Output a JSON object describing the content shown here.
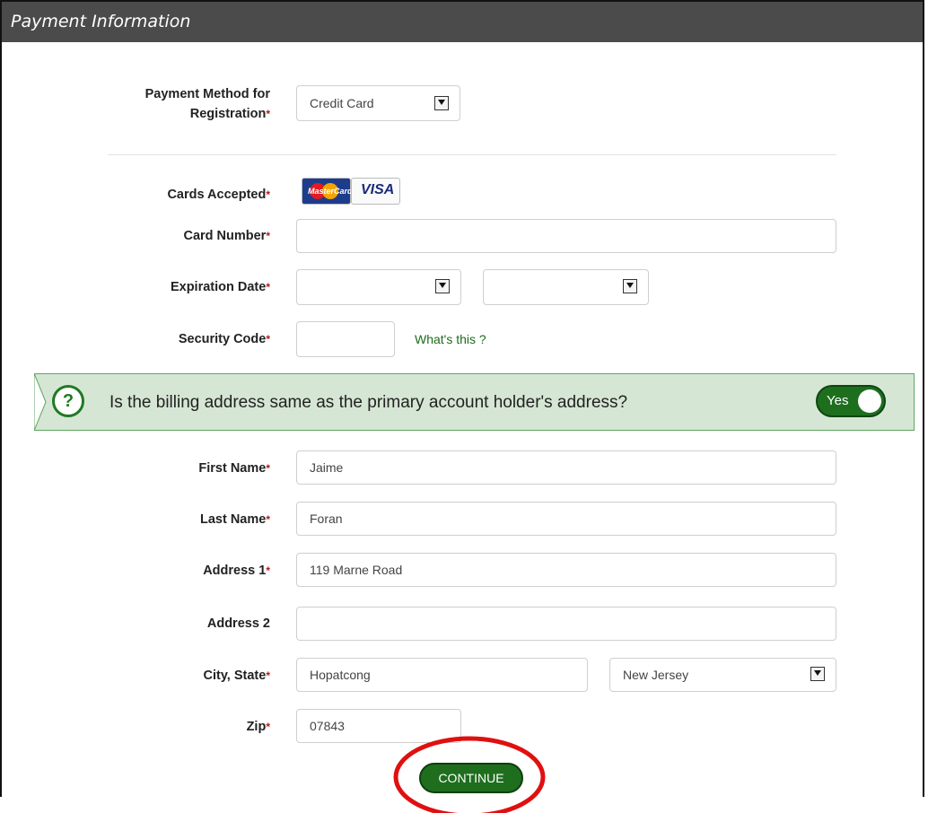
{
  "header": {
    "title": "Payment Information"
  },
  "payment_method": {
    "label_line1": "Payment Method for",
    "label_line2": "Registration",
    "value": "Credit Card"
  },
  "cards_accepted": {
    "label": "Cards Accepted",
    "mastercard_text": "MasterCard",
    "visa_text": "VISA"
  },
  "card_number": {
    "label": "Card Number",
    "value": ""
  },
  "expiration": {
    "label": "Expiration Date",
    "month": "",
    "year": ""
  },
  "security_code": {
    "label": "Security Code",
    "value": "",
    "help_link": "What's this ?"
  },
  "billing_question": {
    "text": "Is the billing address same as the primary account holder's address?",
    "toggle_label": "Yes",
    "icon": "question-circle-icon"
  },
  "fields": {
    "first_name": {
      "label": "First Name",
      "value": "Jaime"
    },
    "last_name": {
      "label": "Last Name",
      "value": "Foran"
    },
    "address1": {
      "label": "Address 1",
      "value": "119 Marne Road"
    },
    "address2": {
      "label": "Address 2",
      "value": ""
    },
    "city_state": {
      "label": "City, State",
      "city": "Hopatcong",
      "state": "New Jersey"
    },
    "zip": {
      "label": "Zip",
      "value": "07843"
    }
  },
  "required_mark": "*",
  "continue_button": {
    "label": "CONTINUE"
  },
  "colors": {
    "header_bg": "#4b4b4b",
    "accent_green": "#1e6e1e",
    "banner_bg": "#d6e6d4",
    "required_red": "#b01818",
    "highlight_red": "#e01010"
  }
}
